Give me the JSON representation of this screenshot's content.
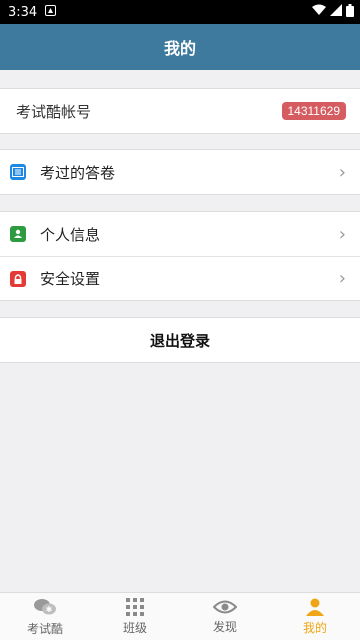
{
  "status": {
    "time": "3:34"
  },
  "header": {
    "title": "我的"
  },
  "account": {
    "label": "考试酷帐号",
    "id": "14311629"
  },
  "menu1": [
    {
      "label": "考过的答卷",
      "icon": "answer-sheet-icon",
      "color": "#1e88e5"
    }
  ],
  "menu2": [
    {
      "label": "个人信息",
      "icon": "person-card-icon",
      "color": "#2e9b40"
    },
    {
      "label": "安全设置",
      "icon": "lock-icon",
      "color": "#e53935"
    }
  ],
  "logout": {
    "label": "退出登录"
  },
  "tabs": [
    {
      "label": "考试酷",
      "icon": "chat-bubble-icon"
    },
    {
      "label": "班级",
      "icon": "grid-icon"
    },
    {
      "label": "发现",
      "icon": "eye-icon"
    },
    {
      "label": "我的",
      "icon": "person-icon",
      "active": true
    }
  ],
  "colors": {
    "header": "#3e7a9d",
    "badge": "#d55c60",
    "active_tab": "#f0a516"
  }
}
